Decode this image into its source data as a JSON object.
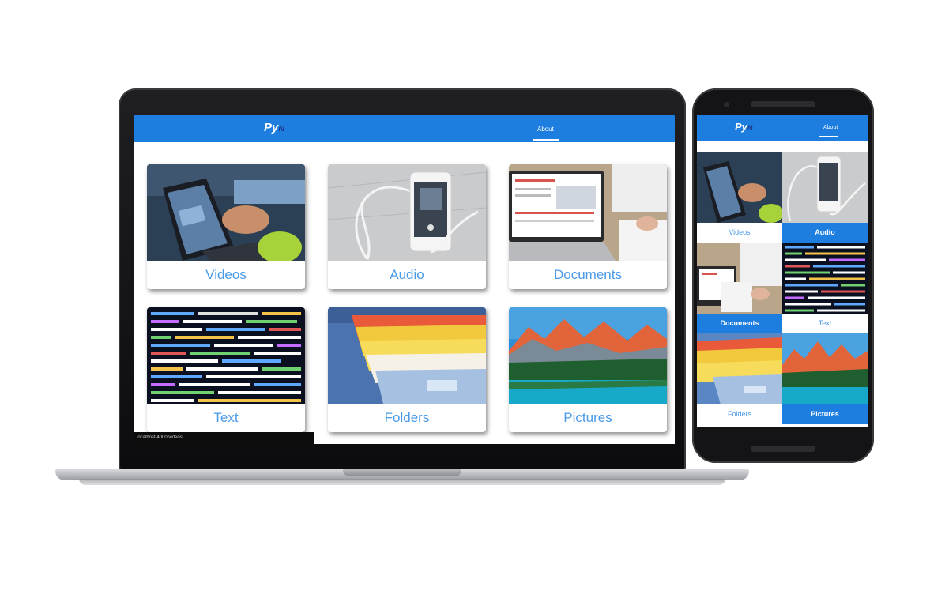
{
  "app": {
    "logo_main": "Py",
    "logo_suffix": "N",
    "nav_tab": "About"
  },
  "categories": [
    {
      "label": "Videos",
      "icon": "laptop-video-icon"
    },
    {
      "label": "Audio",
      "icon": "phone-earbuds-icon"
    },
    {
      "label": "Documents",
      "icon": "dashboard-documents-icon"
    },
    {
      "label": "Text",
      "icon": "code-text-icon"
    },
    {
      "label": "Folders",
      "icon": "file-drawer-icon"
    },
    {
      "label": "Pictures",
      "icon": "mountain-lake-icon"
    }
  ],
  "status_bar_url": "localhost:4000/videos",
  "colors": {
    "appbar": "#1e7ee0",
    "label_text": "#4a9ae8"
  }
}
